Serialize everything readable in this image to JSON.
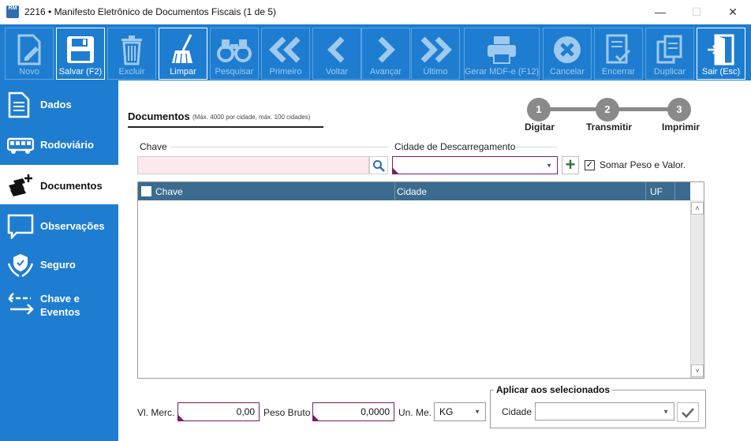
{
  "window": {
    "icon_text": "RM",
    "title": "2216 • Manifesto Eletrônico de Documentos Fiscais (1 de 5)",
    "minimize": "—",
    "maximize": "☐",
    "close": "✕"
  },
  "toolbar": {
    "novo": "Novo",
    "salvar": "Salvar (F2)",
    "excluir": "Excluir",
    "limpar": "Limpar",
    "pesquisar": "Pesquisar",
    "primeiro": "Primeiro",
    "voltar": "Voltar",
    "avancar": "Avançar",
    "ultimo": "Último",
    "gerar": "Gerar MDF-e (F12)",
    "cancelar": "Cancelar",
    "encerrar": "Encerrar",
    "duplicar": "Duplicar",
    "sair": "Sair (Esc)"
  },
  "sidebar": {
    "dados": "Dados",
    "rodoviario": "Rodoviário",
    "documentos": "Documentos",
    "observacoes": "Observações",
    "seguro": "Seguro",
    "chave_line1": "Chave e",
    "chave_line2": "Eventos"
  },
  "section": {
    "title": "Documentos",
    "subtitle": "(Máx. 4000 por cidade, máx. 100 cidades)"
  },
  "steps": [
    {
      "number": "1",
      "label": "Digitar"
    },
    {
      "number": "2",
      "label": "Transmitir"
    },
    {
      "number": "3",
      "label": "Imprimir"
    }
  ],
  "form": {
    "chave_label": "Chave",
    "cidade_label": "Cidade de Descarregamento",
    "plus": "+",
    "somar_label": "Somar Peso e Valor.",
    "somar_check": "✓"
  },
  "grid": {
    "col_chave": "Chave",
    "col_cidade": "Cidade",
    "col_uf": "UF",
    "scroll_up": "˄",
    "scroll_down": "˅"
  },
  "footer": {
    "vl_merc_label": "Vl. Merc.",
    "vl_merc_value": "0,00",
    "peso_label": "Peso Bruto",
    "peso_value": "0,0000",
    "un_label": "Un. Me.",
    "un_value": "KG",
    "group_title": "Aplicar aos selecionados",
    "cidade_label": "Cidade"
  },
  "colors": {
    "accent": "#1e7dd0",
    "grid_header": "#3b6b8f",
    "input_border": "#7a1a6a",
    "chave_bg": "#fde8ee"
  }
}
